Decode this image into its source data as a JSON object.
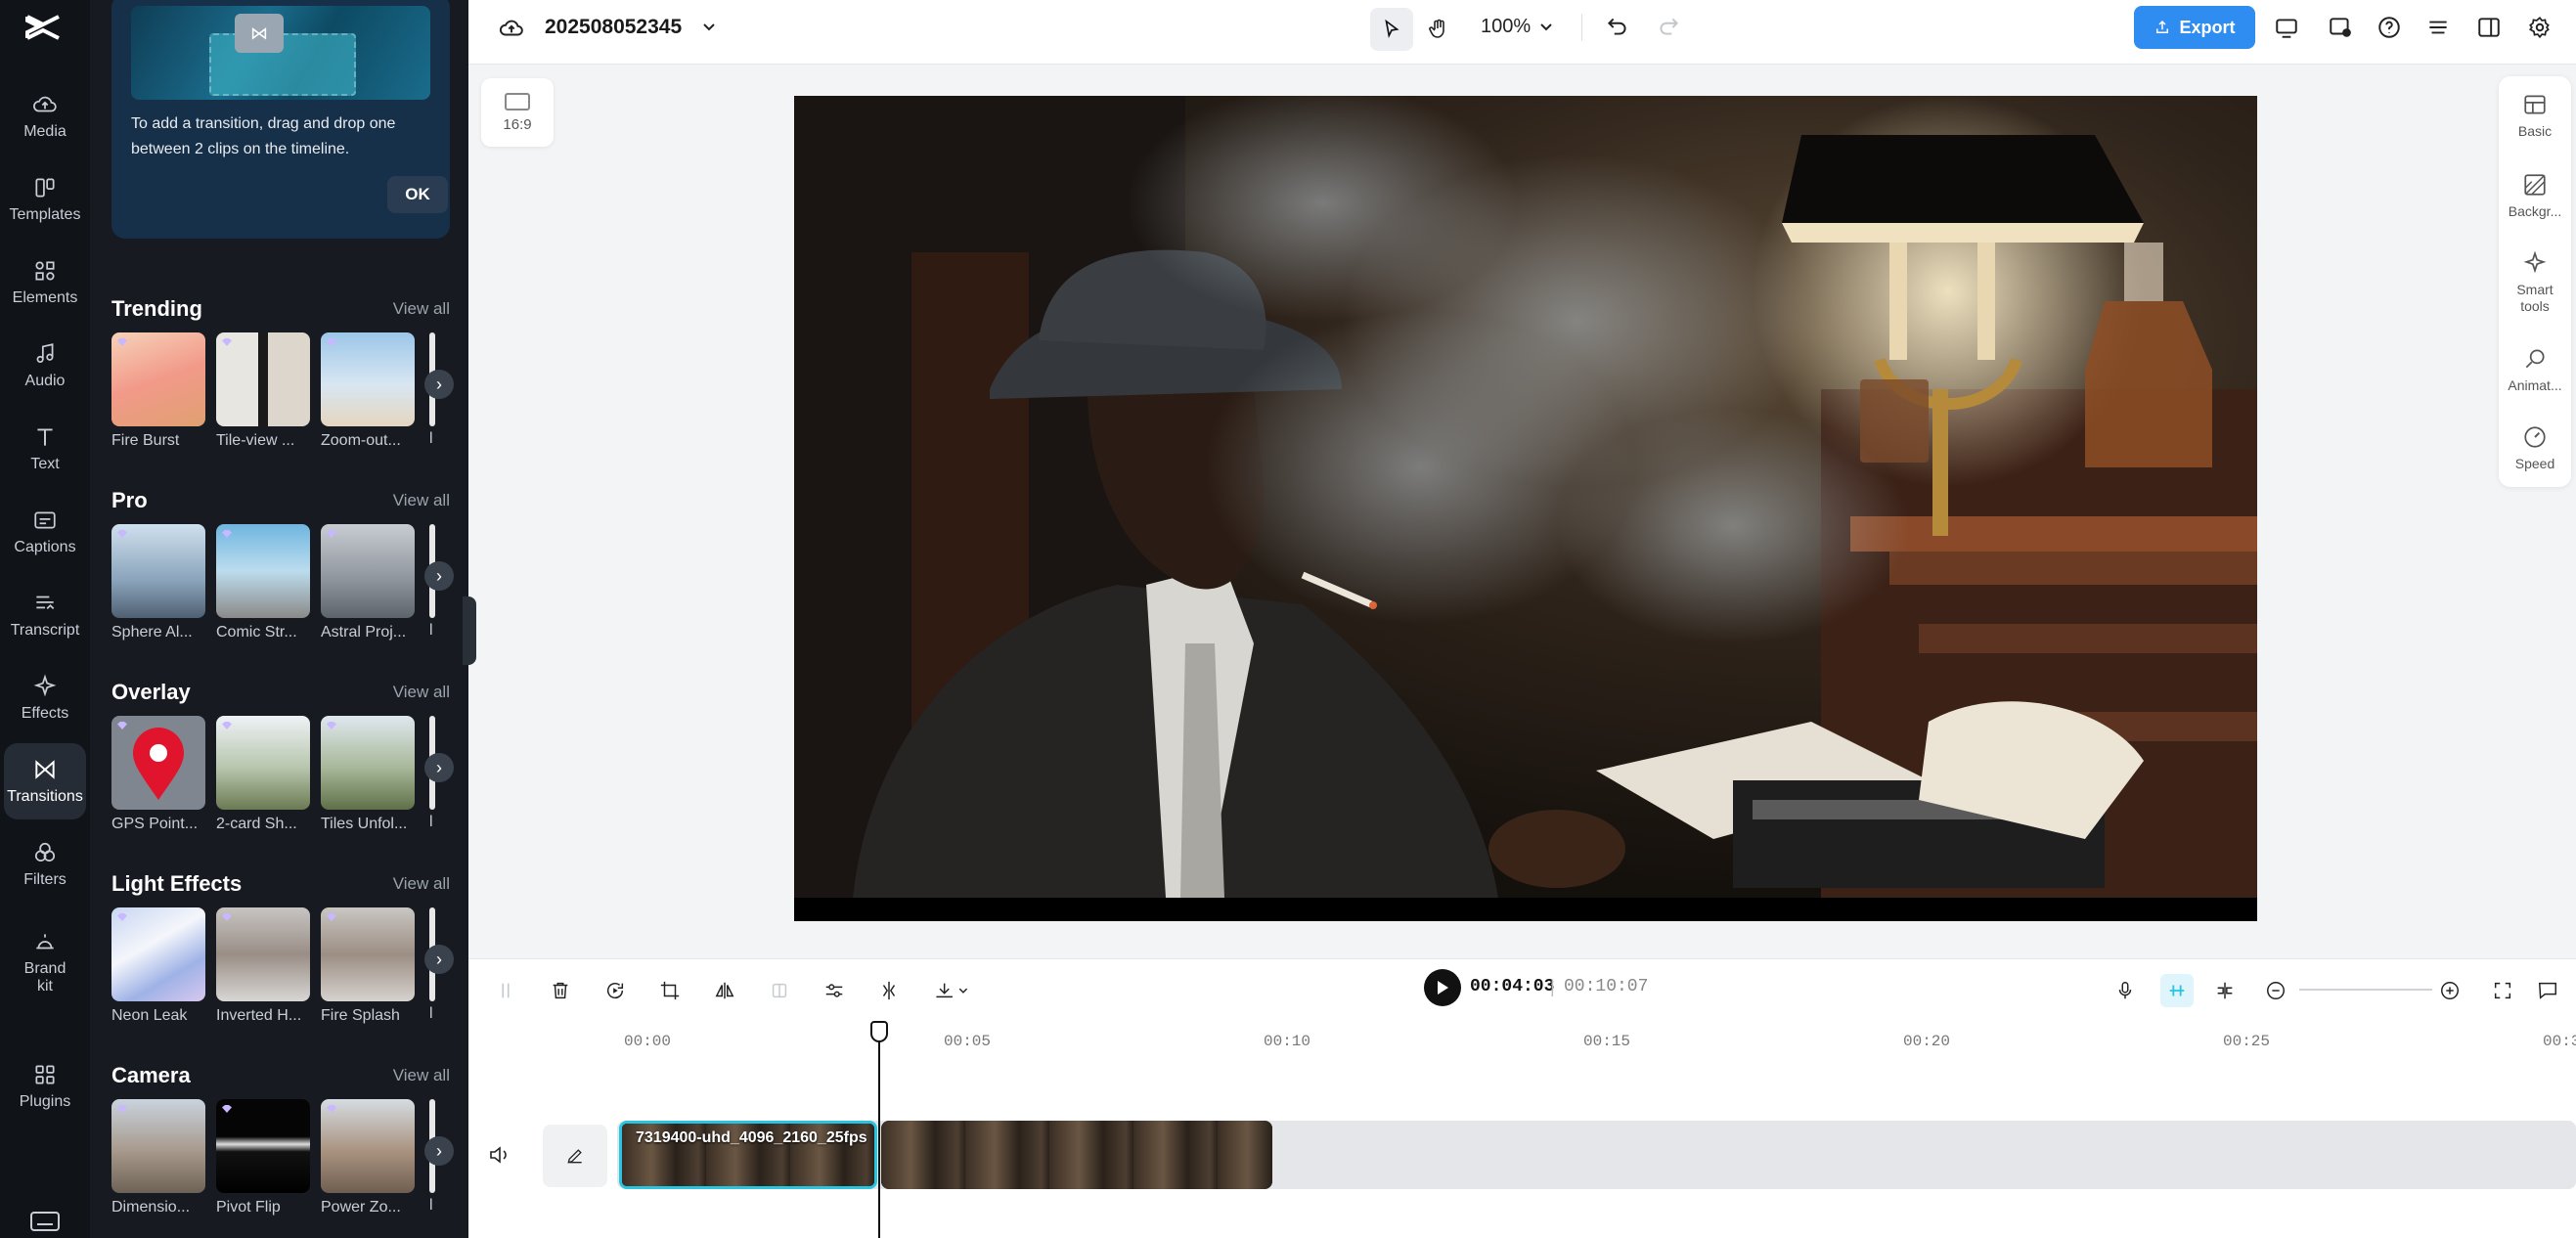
{
  "left_rail": {
    "items": [
      {
        "label": "Media",
        "icon": "cloud-upload-icon"
      },
      {
        "label": "Templates",
        "icon": "templates-icon"
      },
      {
        "label": "Elements",
        "icon": "elements-icon"
      },
      {
        "label": "Audio",
        "icon": "music-note-icon"
      },
      {
        "label": "Text",
        "icon": "text-icon"
      },
      {
        "label": "Captions",
        "icon": "captions-icon"
      },
      {
        "label": "Transcript",
        "icon": "transcript-icon"
      },
      {
        "label": "Effects",
        "icon": "sparkle-icon"
      },
      {
        "label": "Transitions",
        "icon": "bowtie-icon"
      },
      {
        "label": "Filters",
        "icon": "filters-icon"
      },
      {
        "label": "Brand kit",
        "icon": "brand-kit-icon"
      },
      {
        "label": "Plugins",
        "icon": "plugins-icon"
      }
    ],
    "active": "Transitions"
  },
  "panel": {
    "tip": {
      "text": "To add a transition, drag and drop one between 2 clips on the timeline.",
      "ok_label": "OK"
    },
    "view_all_label": "View all",
    "sections": [
      {
        "title": "Trending",
        "items": [
          "Fire Burst",
          "Tile-view ...",
          "Zoom-out..."
        ]
      },
      {
        "title": "Pro",
        "items": [
          "Sphere Al...",
          "Comic Str...",
          "Astral Proj..."
        ]
      },
      {
        "title": "Overlay",
        "items": [
          "GPS Point...",
          "2-card Sh...",
          "Tiles Unfol..."
        ]
      },
      {
        "title": "Light Effects",
        "items": [
          "Neon Leak",
          "Inverted H...",
          "Fire Splash"
        ]
      },
      {
        "title": "Camera",
        "items": [
          "Dimensio...",
          "Pivot Flip",
          "Power Zo..."
        ]
      }
    ]
  },
  "topbar": {
    "project_title": "202508052345",
    "zoom": "100%",
    "export_label": "Export",
    "accent_color": "#2f8cf0"
  },
  "canvas": {
    "ratio_label": "16:9"
  },
  "right_rail": {
    "items": [
      {
        "label": "Basic",
        "icon": "basic-icon"
      },
      {
        "label": "Backgr...",
        "icon": "background-icon"
      },
      {
        "label": "Smart tools",
        "icon": "smart-tools-icon"
      },
      {
        "label": "Animat...",
        "icon": "animation-icon"
      },
      {
        "label": "Speed",
        "icon": "speed-icon"
      }
    ]
  },
  "timeline": {
    "current_time": "00:04:03",
    "separator": "|",
    "total_time": "00:10:07",
    "ruler_labels": [
      "00:00",
      "00:05",
      "00:10",
      "00:15",
      "00:20",
      "00:25",
      "00:3"
    ],
    "clips": [
      {
        "name": "7319400-uhd_4096_2160_25fps",
        "selected": true
      },
      {
        "name": "",
        "selected": false
      }
    ],
    "selection_color": "#29c4e0"
  }
}
